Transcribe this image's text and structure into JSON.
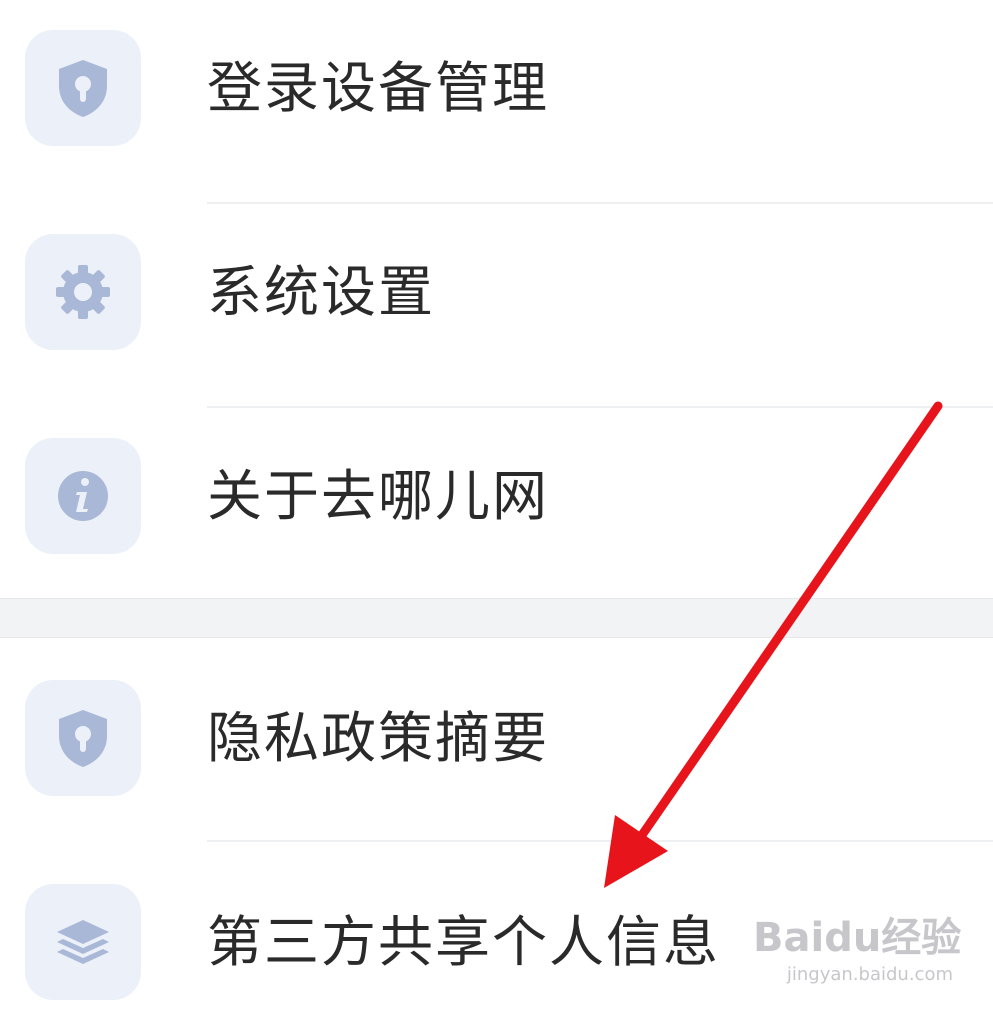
{
  "settings_group_1": {
    "items": [
      {
        "label": "登录设备管理",
        "icon": "shield-lock-icon"
      },
      {
        "label": "系统设置",
        "icon": "gear-icon"
      },
      {
        "label": "关于去哪儿网",
        "icon": "info-icon"
      }
    ]
  },
  "settings_group_2": {
    "items": [
      {
        "label": "隐私政策摘要",
        "icon": "shield-lock-icon"
      },
      {
        "label": "第三方共享个人信息",
        "icon": "layers-icon"
      }
    ]
  },
  "annotation": {
    "arrow_color": "#e8141b",
    "points_to": "第三方共享个人信息"
  },
  "watermark": {
    "main": "Baidu经验",
    "sub": "jingyan.baidu.com"
  },
  "colors": {
    "icon_tile_bg": "#ecf0f9",
    "icon_fg": "#a9b8d6",
    "label_text": "#2a2a2a",
    "divider": "#eeeff1",
    "group_gap": "#f2f3f5"
  }
}
